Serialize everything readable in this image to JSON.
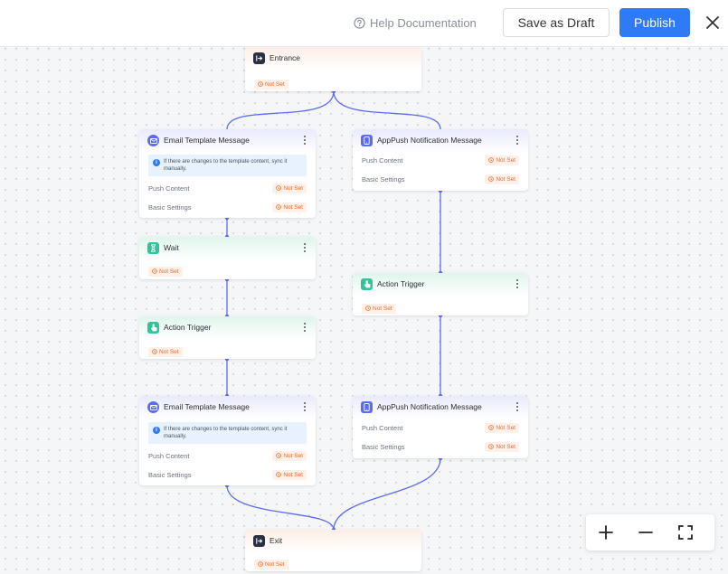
{
  "header": {
    "help_label": "Help Documentation",
    "save_draft_label": "Save as Draft",
    "publish_label": "Publish",
    "close_icon": "close-icon",
    "accent_color": "#2f7bf6"
  },
  "nodes": {
    "entrance": {
      "title": "Entrance",
      "status": "Not Set",
      "icon": "entrance-icon"
    },
    "email1": {
      "title": "Email Template Message",
      "icon": "email-icon",
      "info": "If there are changes to the template content, sync it manually.",
      "rows": [
        {
          "label": "Push Content",
          "status": "Not Set"
        },
        {
          "label": "Basic Settings",
          "status": "Not Set"
        }
      ]
    },
    "app1": {
      "title": "AppPush Notification Message",
      "icon": "mobile-icon",
      "rows": [
        {
          "label": "Push Content",
          "status": "Not Set"
        },
        {
          "label": "Basic Settings",
          "status": "Not Set"
        }
      ]
    },
    "wait": {
      "title": "Wait",
      "status": "Not Set",
      "icon": "hourglass-icon"
    },
    "action_right": {
      "title": "Action Trigger",
      "status": "Not Set",
      "icon": "tap-icon"
    },
    "action_left": {
      "title": "Action Trigger",
      "status": "Not Set",
      "icon": "tap-icon"
    },
    "email2": {
      "title": "Email Template Message",
      "icon": "email-icon",
      "info": "If there are changes to the template content, sync it manually.",
      "rows": [
        {
          "label": "Push Content",
          "status": "Not Set"
        },
        {
          "label": "Basic Settings",
          "status": "Not Set"
        }
      ]
    },
    "app2": {
      "title": "AppPush Notification Message",
      "icon": "mobile-icon",
      "rows": [
        {
          "label": "Push Content",
          "status": "Not Set"
        },
        {
          "label": "Basic Settings",
          "status": "Not Set"
        }
      ]
    },
    "exit": {
      "title": "Exit",
      "status": "Not Set",
      "icon": "exit-icon"
    }
  },
  "zoom_controls": [
    "zoom-in-icon",
    "zoom-out-icon",
    "fullscreen-icon"
  ],
  "colors": {
    "connector": "#5b6cf0",
    "status_text": "#f06a2c",
    "status_bg": "#fff0e8"
  }
}
